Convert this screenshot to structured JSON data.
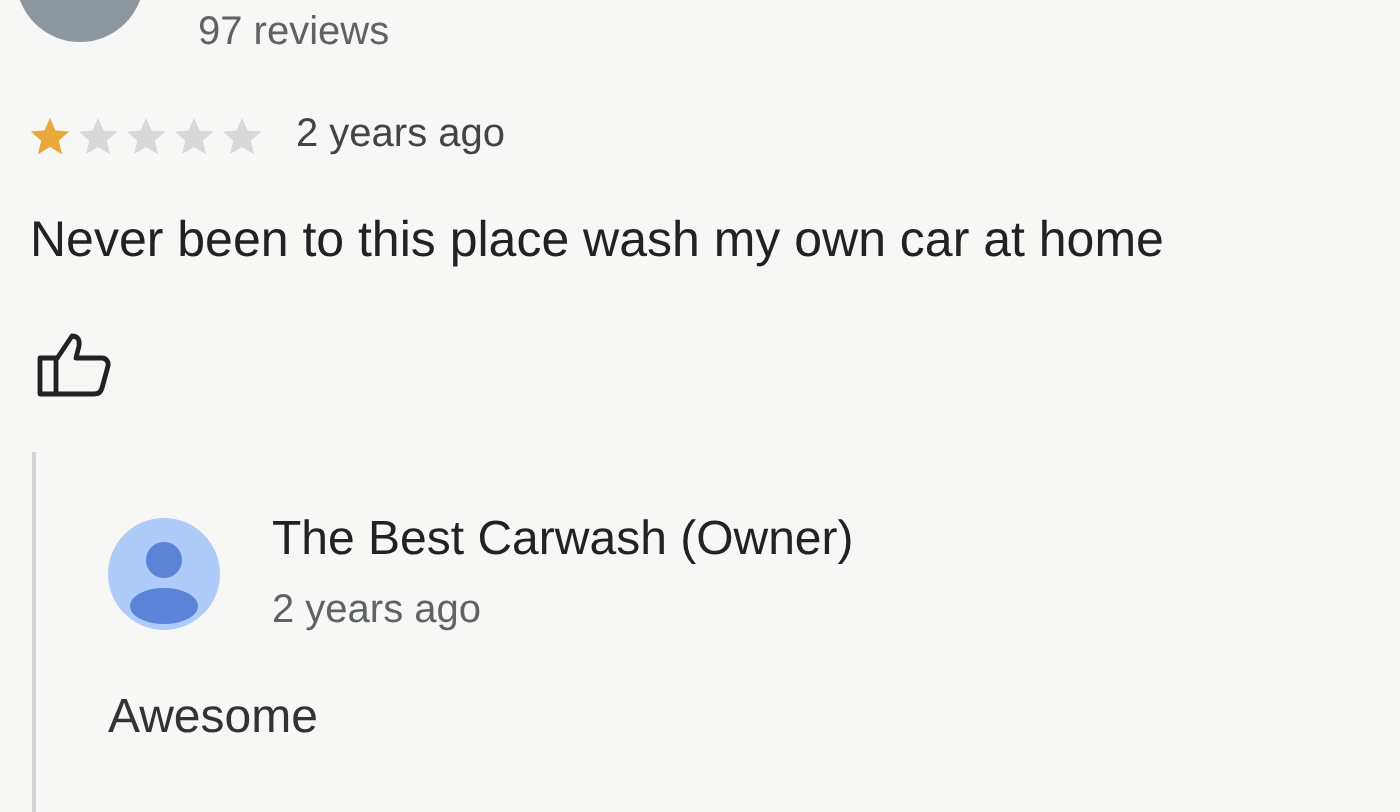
{
  "reviewer": {
    "review_count": "97 reviews"
  },
  "review": {
    "stars": 1,
    "time": "2 years ago",
    "text": "Never been to this place wash my own car at home"
  },
  "owner_reply": {
    "name": "The Best Carwash (Owner)",
    "time": "2 years ago",
    "text": "Awesome"
  }
}
